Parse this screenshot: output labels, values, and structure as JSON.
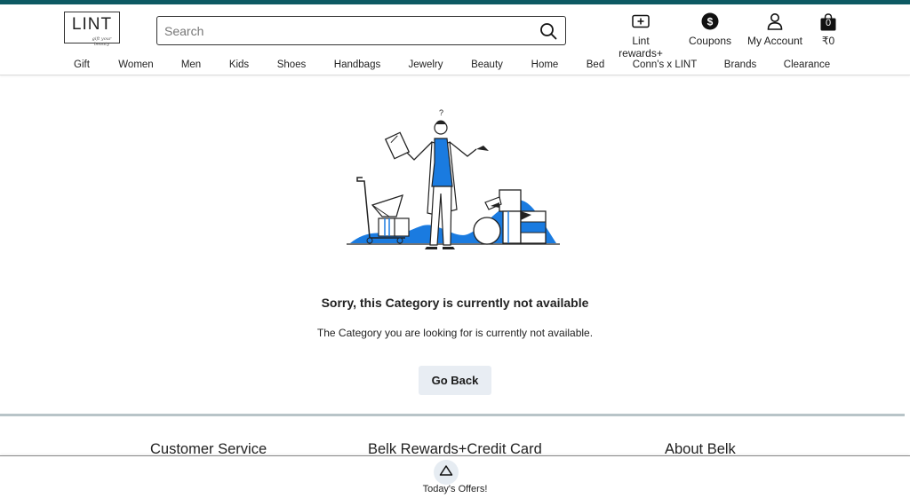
{
  "header": {
    "logo_text": "LINT",
    "logo_tagline": "gift your beauty",
    "search_placeholder": "Search",
    "rewards_label": "Lint rewards+",
    "coupons_label": "Coupons",
    "account_label": "My Account",
    "cart_count": "0",
    "cart_total": "₹0"
  },
  "nav": [
    "Gift",
    "Women",
    "Men",
    "Kids",
    "Shoes",
    "Handbags",
    "Jewelry",
    "Beauty",
    "Home",
    "Bed",
    "Conn's x LINT",
    "Brands",
    "Clearance"
  ],
  "illustration": {
    "question_mark": "?"
  },
  "main": {
    "title": "Sorry, this Category is currently not available",
    "subtitle": "The Category you are looking for is currently not available.",
    "go_back_label": "Go Back"
  },
  "footer": {
    "col1": "Customer Service",
    "col2": "Belk Rewards+Credit Card",
    "col3": "About Belk"
  },
  "bottom_bar": {
    "offers_label": "Today's Offers!"
  },
  "colors": {
    "topbar": "#0d5a63",
    "accent_blue": "#1a7be0",
    "button_bg": "#e8edf3"
  },
  "icons": {
    "search": "search-icon",
    "rewards": "rewards-card-icon",
    "coupons": "dollar-coin-icon",
    "account": "user-icon",
    "cart": "shopping-bag-icon",
    "offers": "chevron-up-icon"
  }
}
